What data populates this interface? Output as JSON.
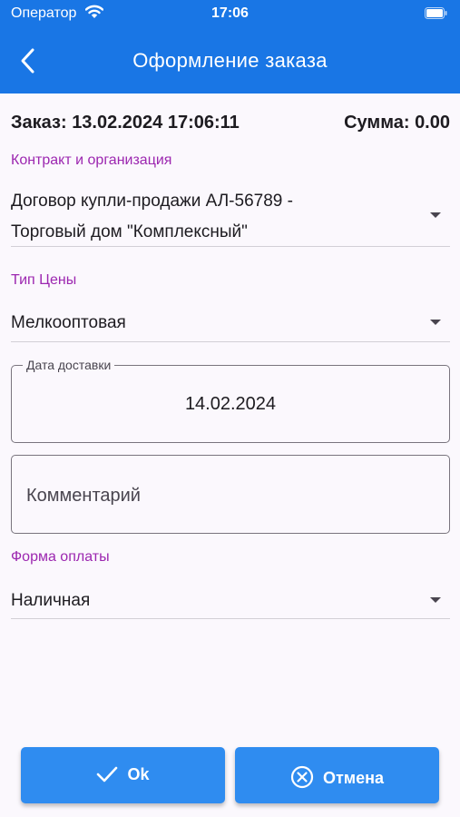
{
  "status_bar": {
    "carrier": "Оператор",
    "time": "17:06"
  },
  "header": {
    "title": "Оформление заказа"
  },
  "summary": {
    "order": "Заказ: 13.02.2024 17:06:11",
    "total": "Сумма: 0.00"
  },
  "contract": {
    "label": "Контракт и организация",
    "line1": "Договор купли-продажи АЛ-56789 -",
    "line2": "Торговый дом \"Комплексный\""
  },
  "price_type": {
    "label": "Тип Цены",
    "value": "Мелкооптовая"
  },
  "delivery": {
    "label": "Дата доставки",
    "value": "14.02.2024"
  },
  "comment": {
    "placeholder": "Комментарий"
  },
  "payment": {
    "label": "Форма оплаты",
    "value": "Наличная"
  },
  "buttons": {
    "ok": "Ok",
    "cancel": "Отмена"
  },
  "colors": {
    "app_bar": "#1976e5",
    "button": "#2f8cf0",
    "field_label": "#9c27b0"
  }
}
